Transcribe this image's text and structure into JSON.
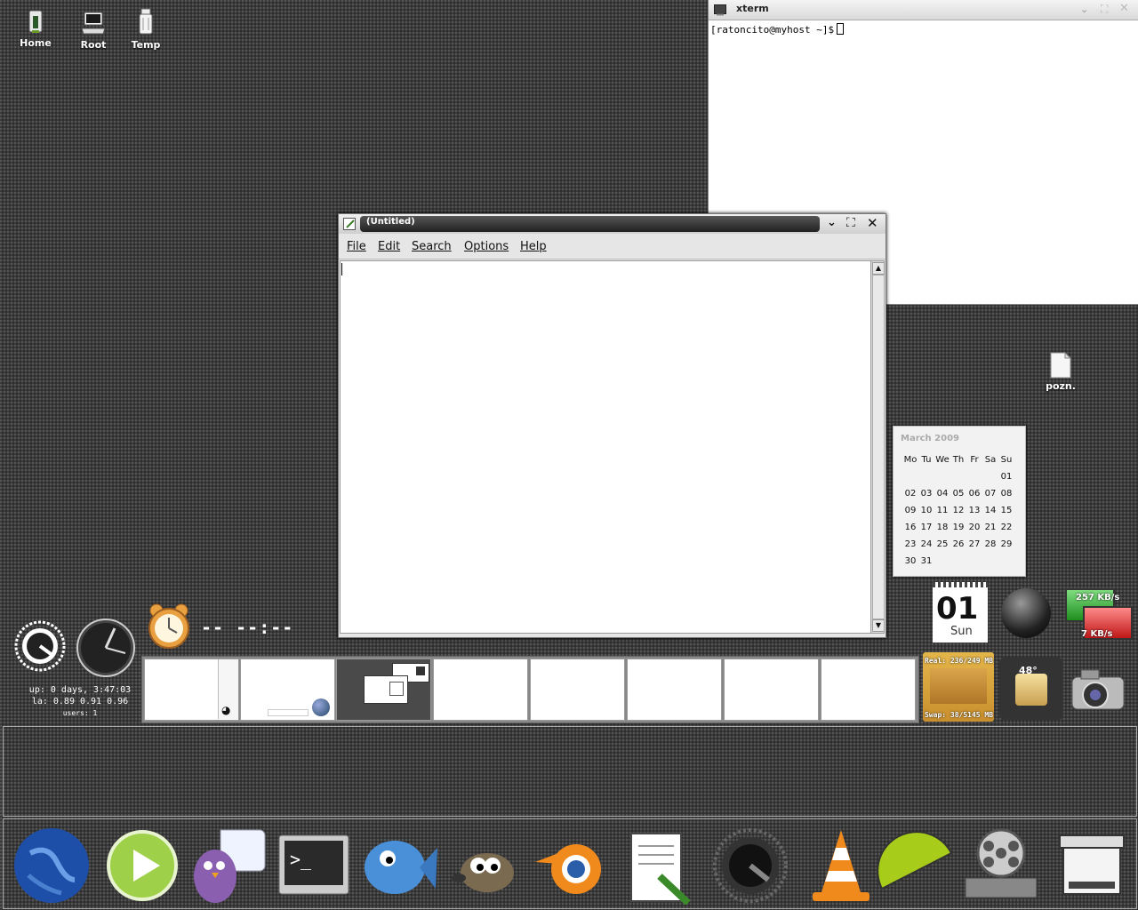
{
  "desktop_icons": [
    {
      "label": "Home"
    },
    {
      "label": "Root"
    },
    {
      "label": "Temp"
    },
    {
      "label": "pozn."
    }
  ],
  "xterm": {
    "title": "xterm",
    "prompt": "[ratoncito@myhost ~]$"
  },
  "editor": {
    "title": "(Untitled)",
    "menu": [
      "File",
      "Edit",
      "Search",
      "Options",
      "Help"
    ]
  },
  "calendar": {
    "title": "March 2009",
    "weekdays": [
      "Mo",
      "Tu",
      "We",
      "Th",
      "Fr",
      "Sa",
      "Su"
    ],
    "weeks": [
      [
        "",
        "",
        "",
        "",
        "",
        "",
        "01"
      ],
      [
        "02",
        "03",
        "04",
        "05",
        "06",
        "07",
        "08"
      ],
      [
        "09",
        "10",
        "11",
        "12",
        "13",
        "14",
        "15"
      ],
      [
        "16",
        "17",
        "18",
        "19",
        "20",
        "21",
        "22"
      ],
      [
        "23",
        "24",
        "25",
        "26",
        "27",
        "28",
        "29"
      ],
      [
        "30",
        "31",
        "",
        "",
        "",
        "",
        ""
      ]
    ]
  },
  "sysinfo": {
    "uptime": "up: 0 days, 3:47:03",
    "load": "la: 0.89 0.91 0.96",
    "users": "users: 1"
  },
  "timer": {
    "display": "-- --:--"
  },
  "date_widget": {
    "day": "01",
    "weekday": "Sun"
  },
  "network": {
    "upload": "257 KB/s",
    "download": "7 KB/s"
  },
  "memory": {
    "real": "Real: 236/249 MB",
    "swap": "Swap: 38/5145 MB"
  },
  "cpu": {
    "temperature": "48°"
  },
  "pager": {
    "desktop_count": 8,
    "active_index": 2
  },
  "dock": {
    "items": [
      "browser-globe-icon",
      "media-player-play-icon",
      "chat-pidgin-icon",
      "terminal-icon",
      "fish-icon",
      "gimp-icon",
      "blender-icon",
      "text-editor-icon",
      "system-dial-icon",
      "vlc-cone-icon",
      "green-half-disc-icon",
      "film-reel-icon",
      "scanner-icon"
    ]
  },
  "colors": {
    "accent": "#2f6fd0",
    "terminal_bg": "#ffffff",
    "calendar_bg": "#f2f2f2"
  }
}
